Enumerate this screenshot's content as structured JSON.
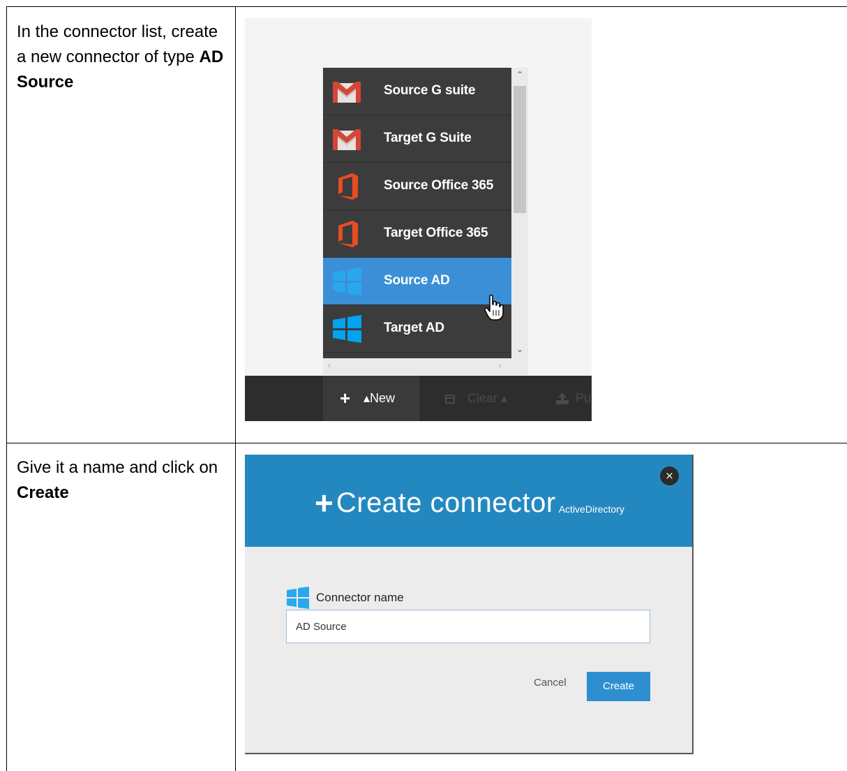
{
  "steps": [
    {
      "instruction_parts": [
        "In the connector list, create a new connector of type ",
        "AD Source"
      ],
      "screenshot": {
        "menu_items": [
          {
            "label": "Source G suite",
            "icon": "gmail-icon"
          },
          {
            "label": "Target G Suite",
            "icon": "gmail-icon"
          },
          {
            "label": "Source Office 365",
            "icon": "office365-icon"
          },
          {
            "label": "Target Office 365",
            "icon": "office365-icon"
          },
          {
            "label": "Source AD",
            "icon": "windows-icon",
            "selected": true
          },
          {
            "label": "Target AD",
            "icon": "windows-icon"
          }
        ],
        "toolbar": {
          "new_label": "▴New",
          "clear_label": "Clear ▴",
          "third_label": "Pu"
        }
      }
    },
    {
      "instruction_parts": [
        "Give it a name and click on ",
        "Create"
      ],
      "screenshot": {
        "dialog_title": "Create connector",
        "dialog_subtitle": "ActiveDirectory",
        "close_label": "×",
        "field_label": "Connector name",
        "field_value": "AD Source",
        "cancel_label": "Cancel",
        "create_label": "Create"
      }
    }
  ],
  "colors": {
    "selected_item": "#3b8fd6",
    "menu_bg": "#3c3c3c",
    "dialog_header": "#2488c0",
    "create_button": "#2e8fd0",
    "gmail_red": "#d44638",
    "office_orange": "#e84c22",
    "windows_blue": "#00a4ef"
  }
}
